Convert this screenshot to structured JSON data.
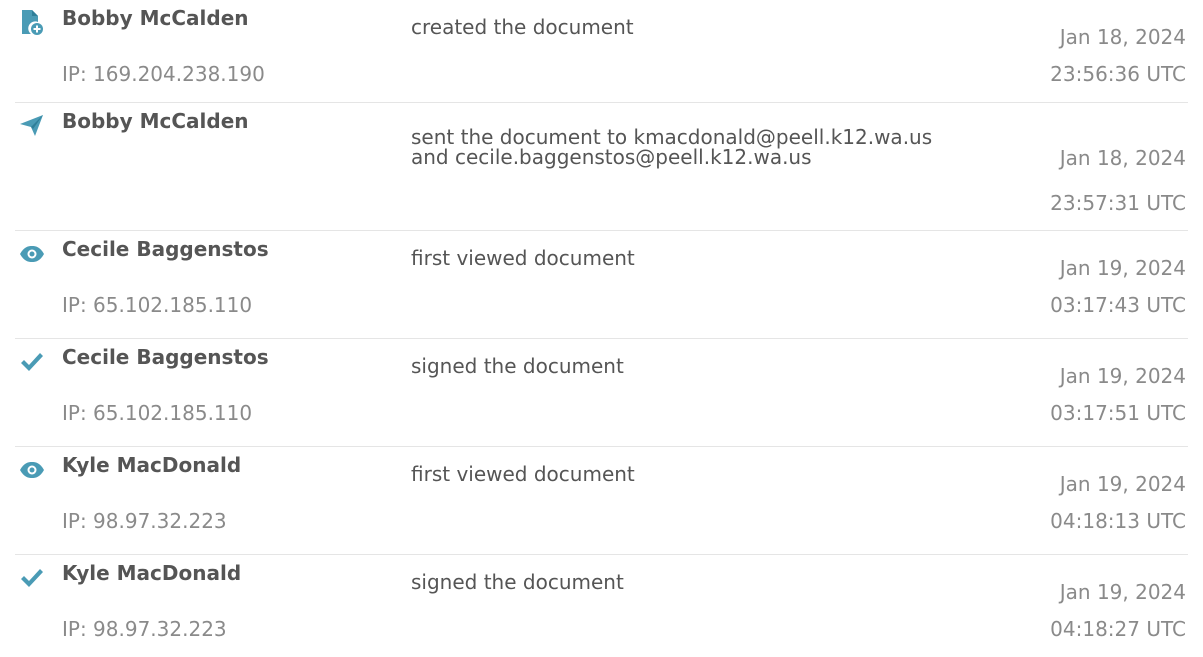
{
  "colors": {
    "icon_accent": "#4a9bb5",
    "text_primary": "#555555",
    "text_secondary": "#8a8a8a",
    "divider": "#e5e5e5"
  },
  "events": [
    {
      "icon": "document-add-icon",
      "actor": "Bobby McCalden",
      "ip": "IP: 169.204.238.190",
      "action_lines": [
        "created the document"
      ],
      "date": "Jan 18, 2024",
      "time": "23:56:36 UTC"
    },
    {
      "icon": "paper-plane-icon",
      "actor": "Bobby McCalden",
      "ip": "",
      "action_lines": [
        "sent the document to kmacdonald@peell.k12.wa.us",
        "and cecile.baggenstos@peell.k12.wa.us"
      ],
      "date": "Jan 18, 2024",
      "time": "23:57:31 UTC"
    },
    {
      "icon": "eye-icon",
      "actor": "Cecile Baggenstos",
      "ip": "IP: 65.102.185.110",
      "action_lines": [
        "first viewed document"
      ],
      "date": "Jan 19, 2024",
      "time": "03:17:43 UTC"
    },
    {
      "icon": "checkmark-icon",
      "actor": "Cecile Baggenstos",
      "ip": "IP: 65.102.185.110",
      "action_lines": [
        "signed the document"
      ],
      "date": "Jan 19, 2024",
      "time": "03:17:51 UTC"
    },
    {
      "icon": "eye-icon",
      "actor": "Kyle MacDonald",
      "ip": "IP: 98.97.32.223",
      "action_lines": [
        "first viewed document"
      ],
      "date": "Jan 19, 2024",
      "time": "04:18:13 UTC"
    },
    {
      "icon": "checkmark-icon",
      "actor": "Kyle MacDonald",
      "ip": "IP: 98.97.32.223",
      "action_lines": [
        "signed the document"
      ],
      "date": "Jan 19, 2024",
      "time": "04:18:27 UTC"
    }
  ]
}
